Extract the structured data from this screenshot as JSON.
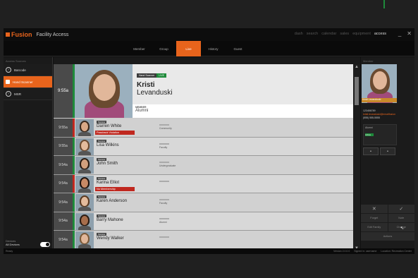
{
  "app": {
    "logo": "Fusion",
    "title": "Facility Access"
  },
  "topnav": [
    "dash",
    "search",
    "calendar",
    "sales",
    "equipment",
    "access"
  ],
  "topnav_active": "access",
  "window_controls": {
    "minimize": "_",
    "close": "✕"
  },
  "tabs": [
    "Member",
    "Group",
    "Live",
    "History",
    "Guest"
  ],
  "active_tab": "Live",
  "left": {
    "header": "Access Sources",
    "sources": [
      {
        "label": "Barcode",
        "active": false
      },
      {
        "label": "Hand Scanner",
        "active": true
      },
      {
        "label": "MSR",
        "active": false
      }
    ],
    "bottom_label": "Devices",
    "bottom_value": "All Devices"
  },
  "center_header": "",
  "featured": {
    "time": "9:55a",
    "badge_label": "Hand Scanner",
    "badge_status": "LIVE",
    "first_name": "Kristi",
    "last_name": "Levanduski",
    "member_label": "MEMBER",
    "member_type": "Alumni"
  },
  "entries": [
    {
      "time": "9:55a",
      "badge": "Scanner",
      "name": "Darren White",
      "alert": "Passback Violation",
      "status": "red",
      "detail": "Community"
    },
    {
      "time": "9:55a",
      "badge": "Scanner",
      "name": "Lisa Wilkins",
      "alert": "",
      "status": "green",
      "detail": "Faculty"
    },
    {
      "time": "9:54a",
      "badge": "Scanner",
      "name": "John Smith",
      "alert": "",
      "status": "green",
      "detail": "Undergraduate"
    },
    {
      "time": "9:54a",
      "badge": "Scanner",
      "name": "Karina Elliot",
      "alert": "No Membership",
      "status": "red",
      "detail": ""
    },
    {
      "time": "9:54a",
      "badge": "Scanner",
      "name": "Karen Anderson",
      "alert": "",
      "status": "green",
      "detail": "Faculty"
    },
    {
      "time": "9:54a",
      "badge": "Scanner",
      "name": "Barry Mahone",
      "alert": "",
      "status": "green",
      "detail": "Alumni"
    },
    {
      "time": "9:54a",
      "badge": "Scanner",
      "name": "Wendy Walker",
      "alert": "",
      "status": "green",
      "detail": ""
    }
  ],
  "right": {
    "header": "Member",
    "name": "Kristi Levanduski",
    "id": "123456789",
    "email": "kristi.levanduski@emailfusion",
    "phone": "(555) 555-5555",
    "box_label": "Alumni",
    "box_status": "Active",
    "actions": [
      [
        "✕",
        "✓"
      ],
      [
        "Forget",
        "Note"
      ],
      [
        "Edit Family",
        "Change"
      ],
      [
        "Actions",
        ""
      ]
    ]
  },
  "status": {
    "left": "Ready",
    "items": [
      "Version 2.0.0.0",
      "Signed in: username",
      "Location: Recreation Center"
    ]
  },
  "colors": {
    "accent": "#e8641c",
    "ok": "#1e8a3a",
    "alert": "#c0281f"
  }
}
